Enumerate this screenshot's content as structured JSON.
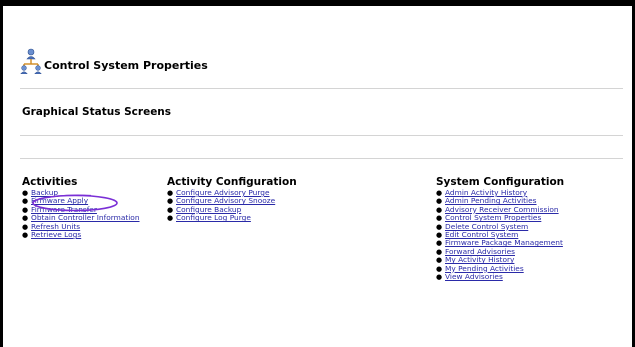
{
  "page": {
    "title": "Control System Properties",
    "section_title": "Graphical Status Screens"
  },
  "activities": {
    "heading": "Activities",
    "items": [
      {
        "label": "Backup"
      },
      {
        "label": "Firmware Apply"
      },
      {
        "label": "Firmware Transfer"
      },
      {
        "label": "Obtain Controller Information"
      },
      {
        "label": "Refresh Units"
      },
      {
        "label": "Retrieve Logs"
      }
    ]
  },
  "activity_configuration": {
    "heading": "Activity Configuration",
    "items": [
      {
        "label": "Configure Advisory Purge"
      },
      {
        "label": "Configure Advisory Snooze"
      },
      {
        "label": "Configure Backup"
      },
      {
        "label": "Configure Log Purge"
      }
    ]
  },
  "system_configuration": {
    "heading": "System Configuration",
    "items": [
      {
        "label": "Admin Activity History"
      },
      {
        "label": "Admin Pending Activities"
      },
      {
        "label": "Advisory Receiver Commission"
      },
      {
        "label": "Control System Properties"
      },
      {
        "label": "Delete Control System"
      },
      {
        "label": "Edit Control System"
      },
      {
        "label": "Firmware Package Management"
      },
      {
        "label": "Forward Advisories"
      },
      {
        "label": "My Activity History"
      },
      {
        "label": "My Pending Activities"
      },
      {
        "label": "View Advisories"
      }
    ]
  },
  "colors": {
    "link": "#2a2aa8",
    "annotation_ellipse": "#7a2fd6",
    "frame": "#000000"
  },
  "icons": {
    "header_icon": "network-users-icon",
    "bullet": "bullet-dot"
  }
}
